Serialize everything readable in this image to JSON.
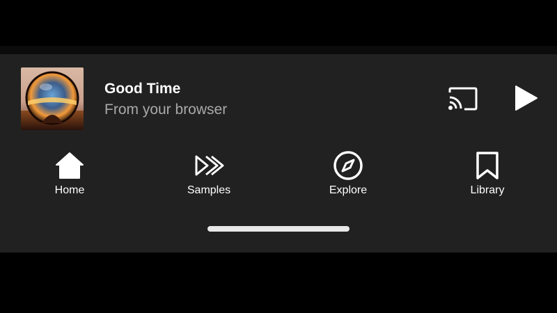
{
  "now_playing": {
    "title": "Good Time",
    "subtitle": "From your browser",
    "cast_icon": "cast-icon",
    "play_icon": "play-icon"
  },
  "nav": {
    "items": [
      {
        "label": "Home",
        "icon": "home-icon"
      },
      {
        "label": "Samples",
        "icon": "samples-icon"
      },
      {
        "label": "Explore",
        "icon": "compass-icon"
      },
      {
        "label": "Library",
        "icon": "bookmark-icon"
      }
    ]
  },
  "colors": {
    "panel": "#212121",
    "background": "#000000",
    "text_primary": "#ffffff",
    "text_secondary": "#a9a9a9"
  }
}
